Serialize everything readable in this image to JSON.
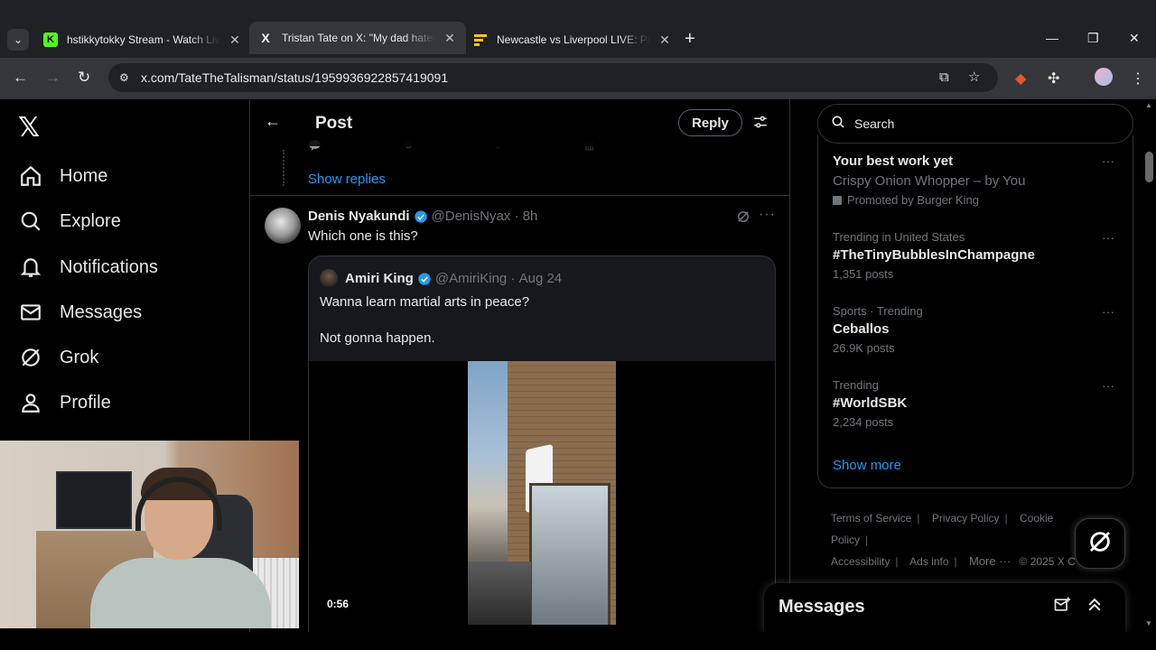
{
  "browser": {
    "tabs": [
      {
        "title": "hstikkytokky Stream - Watch Live",
        "favicon_color": "#53fc18",
        "favicon_letter": "K"
      },
      {
        "title": "Tristan Tate on X: \"My dad hated",
        "favicon_letter": "X"
      },
      {
        "title": "Newcastle vs Liverpool LIVE: Pre",
        "favicon_color": "#f5c518"
      }
    ],
    "url": "x.com/TateTheTalisman/status/1959936922857419091"
  },
  "nav": {
    "items": [
      {
        "label": "Home",
        "icon": "home-icon"
      },
      {
        "label": "Explore",
        "icon": "search-icon"
      },
      {
        "label": "Notifications",
        "icon": "bell-icon"
      },
      {
        "label": "Messages",
        "icon": "envelope-icon"
      },
      {
        "label": "Grok",
        "icon": "grok-icon"
      },
      {
        "label": "Profile",
        "icon": "person-icon"
      }
    ]
  },
  "post": {
    "header_title": "Post",
    "reply_label": "Reply",
    "show_replies": "Show replies",
    "reply": {
      "name": "Denis Nyakundi",
      "handle": "@DenisNyax",
      "time": "8h",
      "text": "Which one is this?"
    },
    "quote": {
      "name": "Amiri King",
      "handle": "@AmiriKing",
      "date": "Aug 24",
      "line1": "Wanna learn martial arts in peace?",
      "line2": "Not gonna happen.",
      "video_time": "0:56"
    }
  },
  "sidebar": {
    "search_placeholder": "Search",
    "promo": {
      "title": "Your best work yet",
      "subtitle": "Crispy Onion Whopper – by You",
      "promoted_by": "Promoted by Burger King"
    },
    "trends": [
      {
        "meta": "Trending in United States",
        "topic": "#TheTinyBubblesInChampagne",
        "count": "1,351 posts"
      },
      {
        "meta": "Sports · Trending",
        "topic": "Ceballos",
        "count": "26.9K posts"
      },
      {
        "meta": "Trending",
        "topic": "#WorldSBK",
        "count": "2,234 posts"
      }
    ],
    "show_more": "Show more",
    "footer": {
      "terms": "Terms of Service",
      "privacy": "Privacy Policy",
      "cookie": "Cookie Policy",
      "accessibility": "Accessibility",
      "ads": "Ads info",
      "more": "More ···",
      "copyright": "© 2025 X C"
    }
  },
  "messages_drawer": {
    "title": "Messages"
  },
  "colors": {
    "accent": "#1d9bf0",
    "background": "#000000",
    "verified": "#1d9bf0"
  }
}
